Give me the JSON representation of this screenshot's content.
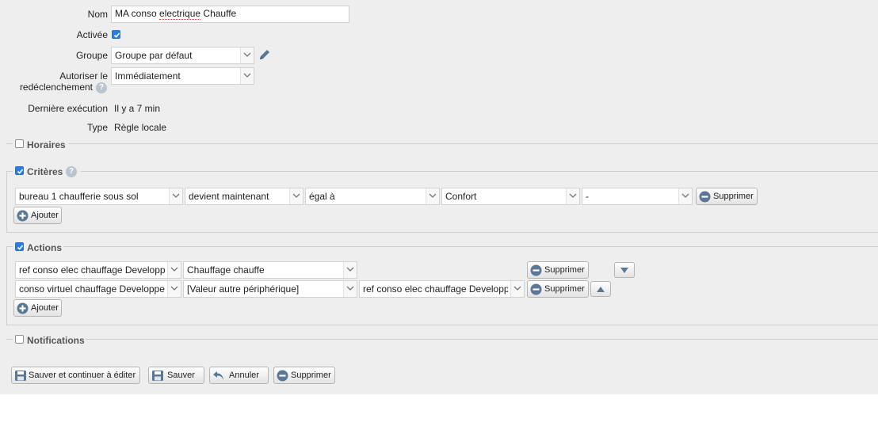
{
  "form": {
    "nom_label": "Nom",
    "nom_value_prefix": "MA conso ",
    "nom_value_misspelled": "electrique",
    "nom_value_suffix": " Chauffe",
    "activee_label": "Activée",
    "activee_checked": true,
    "groupe_label": "Groupe",
    "groupe_value": "Groupe par défaut",
    "redeclenchement_label_1": "Autoriser le",
    "redeclenchement_label_2": "redéclenchement",
    "redeclenchement_value": "Immédiatement",
    "derniere_label": "Dernière exécution",
    "derniere_value": "Il y a 7 min",
    "type_label": "Type",
    "type_value": "Règle locale"
  },
  "sections": {
    "horaires": {
      "label": "Horaires",
      "checked": false
    },
    "criteres": {
      "label": "Critères",
      "checked": true
    },
    "actions": {
      "label": "Actions",
      "checked": true
    },
    "notifications": {
      "label": "Notifications",
      "checked": false
    }
  },
  "criteres": {
    "row": {
      "device": "bureau 1 chaufferie sous sol",
      "operator": "devient maintenant",
      "comparison": "égal à",
      "value": "Confort",
      "extra": "-",
      "delete_label": "Supprimer"
    },
    "add_label": "Ajouter"
  },
  "actions": {
    "rows": [
      {
        "device": "ref conso elec chauffage Developpe",
        "value": "Chauffage chauffe",
        "delete_label": "Supprimer",
        "move": "down"
      },
      {
        "device": "conso virtuel chauffage Developper",
        "value": "[Valeur autre périphérique]",
        "source": "ref conso elec chauffage Developpe",
        "delete_label": "Supprimer",
        "move": "up"
      }
    ],
    "add_label": "Ajouter"
  },
  "footer": {
    "save_continue_label": "Sauver et continuer à éditer",
    "save_label": "Sauver",
    "cancel_label": "Annuler",
    "delete_label": "Supprimer"
  },
  "colors": {
    "accent": "#2a7de1",
    "icon_blue": "#5a7896",
    "panel_bg": "#eeeeee"
  }
}
